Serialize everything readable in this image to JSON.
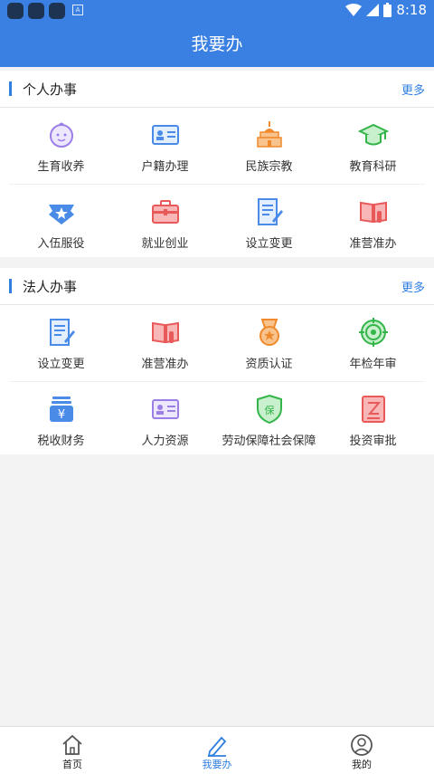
{
  "status": {
    "time": "8:18"
  },
  "appbar": {
    "title": "我要办"
  },
  "personal": {
    "title": "个人办事",
    "more": "更多",
    "items": [
      {
        "label": "生育收养",
        "icon": "baby-icon"
      },
      {
        "label": "户籍办理",
        "icon": "id-card-icon"
      },
      {
        "label": "民族宗教",
        "icon": "temple-icon"
      },
      {
        "label": "教育科研",
        "icon": "graduation-cap-icon"
      },
      {
        "label": "入伍服役",
        "icon": "military-badge-icon"
      },
      {
        "label": "就业创业",
        "icon": "briefcase-icon"
      },
      {
        "label": "设立变更",
        "icon": "document-edit-icon"
      },
      {
        "label": "准营准办",
        "icon": "book-hand-icon"
      }
    ]
  },
  "legal": {
    "title": "法人办事",
    "more": "更多",
    "items": [
      {
        "label": "设立变更",
        "icon": "document-edit-icon"
      },
      {
        "label": "准营准办",
        "icon": "book-hand-icon"
      },
      {
        "label": "资质认证",
        "icon": "medal-icon"
      },
      {
        "label": "年检年审",
        "icon": "target-icon"
      },
      {
        "label": "税收财务",
        "icon": "yuan-stack-icon"
      },
      {
        "label": "人力资源",
        "icon": "person-card-icon"
      },
      {
        "label": "劳动保障社会保障",
        "icon": "shield-bao-icon"
      },
      {
        "label": "投资审批",
        "icon": "approval-doc-icon"
      }
    ]
  },
  "tabs": [
    {
      "label": "首页",
      "icon": "home-icon"
    },
    {
      "label": "我要办",
      "icon": "pencil-icon"
    },
    {
      "label": "我的",
      "icon": "user-icon"
    }
  ],
  "colors": {
    "primary": "#3a7fe2",
    "accent": "#2f7ee0"
  }
}
